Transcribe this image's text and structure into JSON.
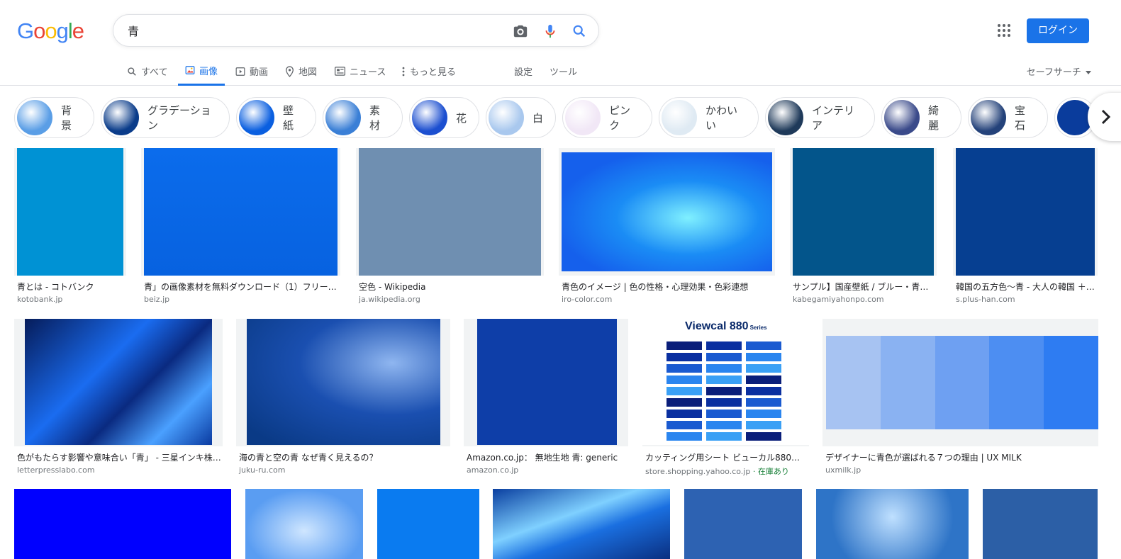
{
  "logo": {
    "letters": [
      {
        "ch": "G",
        "color": "#4285f4"
      },
      {
        "ch": "o",
        "color": "#ea4335"
      },
      {
        "ch": "o",
        "color": "#fbbc05"
      },
      {
        "ch": "g",
        "color": "#4285f4"
      },
      {
        "ch": "l",
        "color": "#34a853"
      },
      {
        "ch": "e",
        "color": "#ea4335"
      }
    ]
  },
  "search": {
    "value": "青"
  },
  "header": {
    "login_label": "ログイン"
  },
  "tabs": {
    "all": "すべて",
    "images": "画像",
    "videos": "動画",
    "maps": "地図",
    "news": "ニュース",
    "more": "もっと見る",
    "settings": "設定",
    "tools": "ツール"
  },
  "safesearch": "セーフサーチ",
  "chips": [
    {
      "label": "背景",
      "color": "#5a9ee6"
    },
    {
      "label": "グラデーション",
      "color": "#0a3c8a"
    },
    {
      "label": "壁紙",
      "color": "#0a5fe0"
    },
    {
      "label": "素材",
      "color": "#3a7fd6"
    },
    {
      "label": "花",
      "color": "#1c4fd0"
    },
    {
      "label": "白",
      "color": "#a9c8ee"
    },
    {
      "label": "ピンク",
      "color": "#f1e7f6"
    },
    {
      "label": "かわいい",
      "color": "#dfeaf3"
    },
    {
      "label": "インテリア",
      "color": "#1f3a5a"
    },
    {
      "label": "綺麗",
      "color": "#3a4a8a"
    },
    {
      "label": "宝石",
      "color": "#24427a"
    }
  ],
  "results": [
    {
      "title": "青とは - コトバンク",
      "source": "kotobank.jp",
      "color": "#0092d4"
    },
    {
      "title": "青」の画像素材を無料ダウンロード（1）フリー…",
      "source": "beiz.jp",
      "color": "#0a6ae6"
    },
    {
      "title": "空色 - Wikipedia",
      "source": "ja.wikipedia.org",
      "color": "#6f8fb1"
    },
    {
      "title": "青色のイメージ | 色の性格・心理効果・色彩連想",
      "source": "iro-color.com",
      "color": "#1560ec"
    },
    {
      "title": "サンプル】国産壁紙 / ブルー・青…",
      "source": "kabegamiyahonpo.com",
      "color": "#03558b"
    },
    {
      "title": "韓国の五方色〜青 - 大人の韓国 ＋h…",
      "source": "s.plus-han.com",
      "color": "#063f91"
    },
    {
      "title": "色がもたらす影響や意味合い「青」 - 三星インキ株…",
      "source": "letterpresslabo.com",
      "color": "#0a50c8"
    },
    {
      "title": "海の青と空の青 なぜ青く見えるの？",
      "source": "juku-ru.com",
      "color": "#0a3a86"
    },
    {
      "title": "Amazon.co.jp： 無地生地 青: generic",
      "source": "amazon.co.jp",
      "color": "#0e3ea8"
    },
    {
      "title": "カッティング用シート ビューカル880シ…",
      "source": "store.shopping.yahoo.co.jp",
      "stock": "在庫あり",
      "color": "#ffffff"
    },
    {
      "title": "デザイナーに青色が選ばれる７つの理由 | UX MILK",
      "source": "uxmilk.jp",
      "color": "#7aa9f2"
    }
  ],
  "row3_colors": [
    "#0000ff",
    "#5a9df2",
    "#0a7bf0",
    "#1c6fd8",
    "#2d62b2",
    "#2e74c7",
    "#2c5fa6"
  ],
  "viewcal_title": "Viewcal 880",
  "viewcal_sub": "Series",
  "palette": [
    "#a7c3f2",
    "#8ab2f2",
    "#6ea0f2",
    "#4d8ef2",
    "#2e7cf2"
  ]
}
